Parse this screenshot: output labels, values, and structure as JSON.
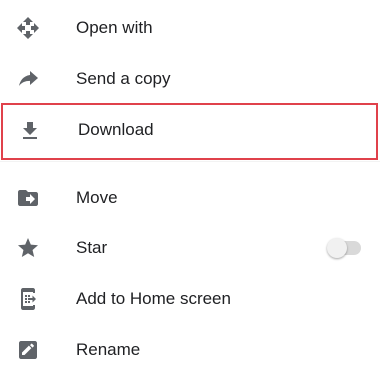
{
  "menu": {
    "items": [
      {
        "label": "Open with",
        "icon": "open-with-icon"
      },
      {
        "label": "Send a copy",
        "icon": "share-arrow-icon"
      },
      {
        "label": "Download",
        "icon": "download-icon"
      },
      {
        "label": "Move",
        "icon": "move-folder-icon"
      },
      {
        "label": "Star",
        "icon": "star-icon",
        "toggle_on": false
      },
      {
        "label": "Add to Home screen",
        "icon": "add-to-home-icon"
      },
      {
        "label": "Rename",
        "icon": "rename-icon"
      }
    ]
  },
  "colors": {
    "icon": "#5f6368",
    "text": "#202124",
    "highlight_border": "#e0414b",
    "toggle_track": "#d9d9d9",
    "toggle_thumb": "#f1f1f1"
  }
}
